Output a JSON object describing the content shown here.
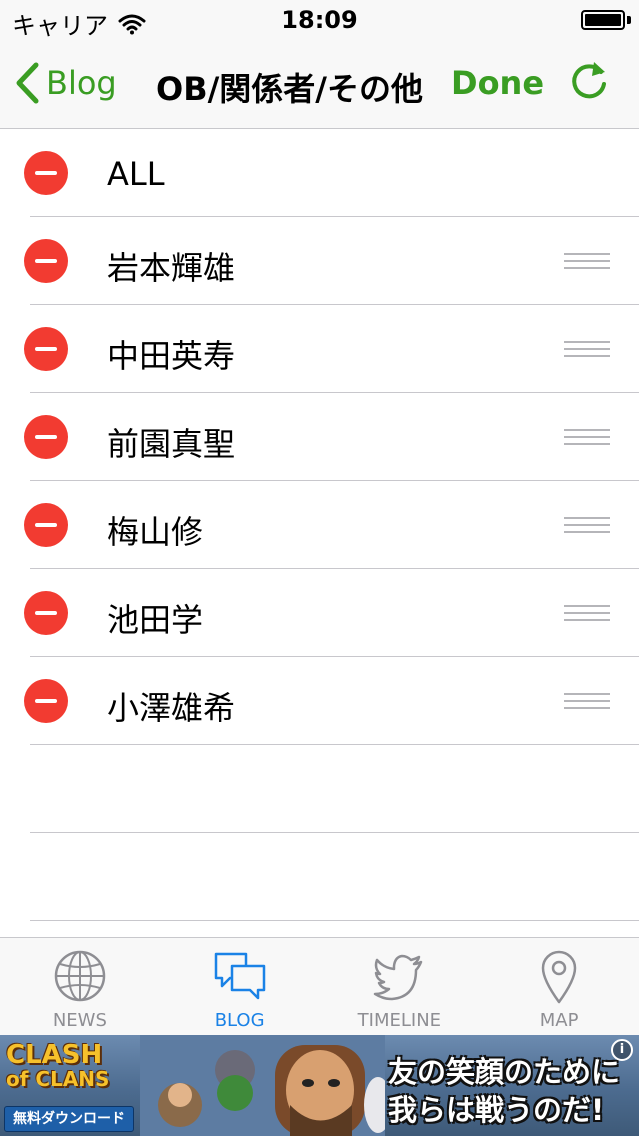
{
  "status_bar": {
    "carrier": "キャリア",
    "time": "18:09",
    "icons": [
      "wifi-icon",
      "battery-icon"
    ]
  },
  "nav_bar": {
    "back_label": "Blog",
    "title": "OB/関係者/その他",
    "done_label": "Done",
    "refresh_icon": "refresh-icon",
    "accent_color": "#3a9d23"
  },
  "list": {
    "rows": [
      {
        "label": "ALL",
        "reorderable": false
      },
      {
        "label": "岩本輝雄",
        "reorderable": true
      },
      {
        "label": "中田英寿",
        "reorderable": true
      },
      {
        "label": "前園真聖",
        "reorderable": true
      },
      {
        "label": "梅山修",
        "reorderable": true
      },
      {
        "label": "池田学",
        "reorderable": true
      },
      {
        "label": "小澤雄希",
        "reorderable": true
      }
    ],
    "delete_color": "#f23b31"
  },
  "tab_bar": {
    "tabs": [
      {
        "label": "NEWS",
        "icon": "globe-icon",
        "active": false
      },
      {
        "label": "BLOG",
        "icon": "chat-bubbles-icon",
        "active": true
      },
      {
        "label": "TIMELINE",
        "icon": "bird-icon",
        "active": false
      },
      {
        "label": "MAP",
        "icon": "map-pin-icon",
        "active": false
      }
    ],
    "active_color": "#1a82e6",
    "inactive_color": "#8e8e93"
  },
  "ad": {
    "logo_line1": "CLASH",
    "logo_line2": "of CLANS",
    "download_label": "無料ダウンロード",
    "headline_line1": "友の笑顔のために",
    "headline_line2": "我らは戦うのだ!",
    "info_label": "i"
  }
}
